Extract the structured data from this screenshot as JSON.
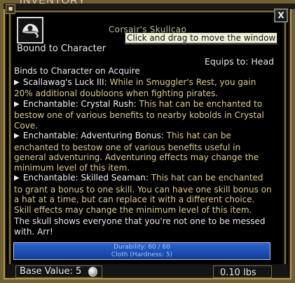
{
  "window": {
    "title": "INVENTORY",
    "close_label": "X",
    "menu_icon_glyph": "▪"
  },
  "item": {
    "icon": "pirate-hat-icon",
    "name": "Corsair's Skullcap",
    "bound": "Bound to Character",
    "equips": "Equips to: Head",
    "tooltip": "Click and drag to move the window"
  },
  "binds": "Binds to Character on Acquire",
  "effects": [
    {
      "name": "Scallawag's Luck III:",
      "description": "While in Smuggler's Rest, you gain 20% additional doubloons when fighting pirates."
    },
    {
      "name": "Enchantable: Crystal Rush:",
      "description": "This hat can be enchanted to bestow one of various benefits to nearby kobolds in Crystal Cove."
    },
    {
      "name": "Enchantable: Adventuring Bonus:",
      "description": "This hat can be enchanted to bestow one of various benefits useful in general adventuring. Adventuring effects may change the minimum level of this item."
    },
    {
      "name": "Enchantable: Skilled Seaman:",
      "description": "This hat can be enchanted to grant a bonus to one skill. You can have one skill bonus on a hat at a time, but can replace it with a different choice. Skill effects may change the minimum level of this item."
    }
  ],
  "flavor": "The skull shows everyone that you're not one to be messed with. Arr!",
  "durability": {
    "text": "Durability: 60 / 60",
    "fraction": 1.0,
    "material": "Cloth (Hardness: 5)"
  },
  "footer": {
    "base_value": "Base Value: 5",
    "coin_icon": "silver-coin-icon",
    "weight": "0.10 lbs"
  },
  "colors": {
    "effect_description": "#d9c98c",
    "frame_gold": "#b39b52",
    "durability_blue": "#1240a0"
  }
}
